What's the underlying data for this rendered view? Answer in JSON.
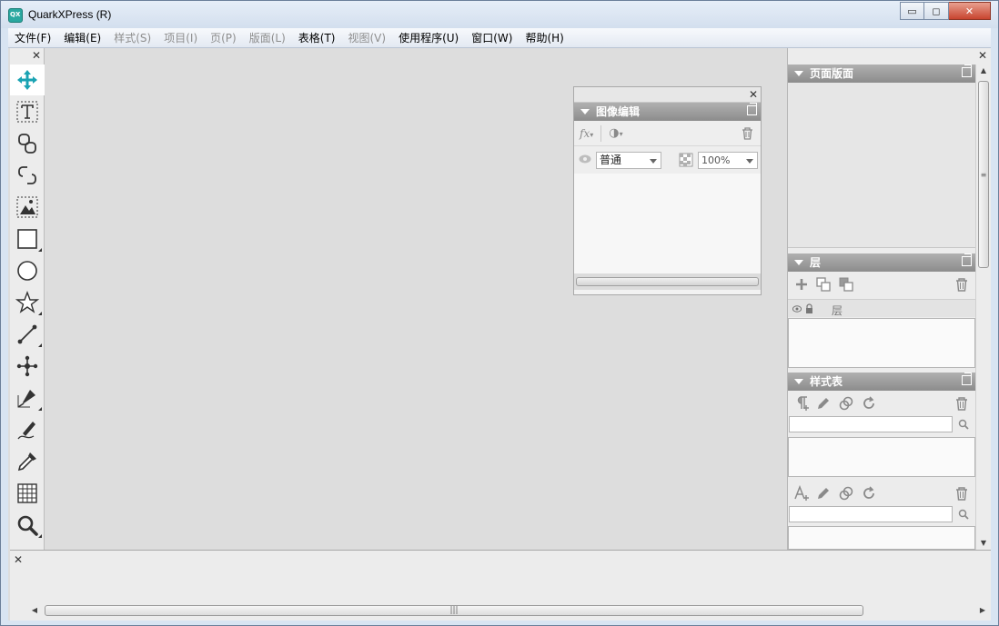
{
  "window": {
    "title": "QuarkXPress (R)",
    "controls": {
      "minimize": "▭",
      "maximize": "◻",
      "close": "✕"
    }
  },
  "menubar": [
    {
      "label": "文件(F)",
      "enabled": true
    },
    {
      "label": "编辑(E)",
      "enabled": true
    },
    {
      "label": "样式(S)",
      "enabled": false
    },
    {
      "label": "项目(I)",
      "enabled": false
    },
    {
      "label": "页(P)",
      "enabled": false
    },
    {
      "label": "版面(L)",
      "enabled": false
    },
    {
      "label": "表格(T)",
      "enabled": true
    },
    {
      "label": "视图(V)",
      "enabled": false
    },
    {
      "label": "使用程序(U)",
      "enabled": true
    },
    {
      "label": "窗口(W)",
      "enabled": true
    },
    {
      "label": "帮助(H)",
      "enabled": true
    }
  ],
  "tools": [
    "move-tool-icon",
    "text-content-tool-icon",
    "link-tool-icon",
    "unlink-tool-icon",
    "picture-content-tool-icon",
    "rectangle-box-tool-icon",
    "oval-box-tool-icon",
    "starburst-tool-icon",
    "line-tool-icon",
    "point-tool-icon",
    "bezier-pen-tool-icon",
    "freehand-tool-icon",
    "eyedropper-tool-icon",
    "table-tool-icon",
    "zoom-tool-icon"
  ],
  "image_edit_palette": {
    "title": "图像编辑",
    "fx_label": "fx",
    "blend_mode": "普通",
    "opacity": "100%"
  },
  "right_dock": {
    "page_layout_title": "页面版面",
    "layers_title": "层",
    "layer_column_label": "层",
    "style_sheets_title": "样式表"
  },
  "colors": {
    "active_tool": "#1aa3b3",
    "panel_header": "#9a9a9a",
    "workspace": "#dddddd"
  }
}
